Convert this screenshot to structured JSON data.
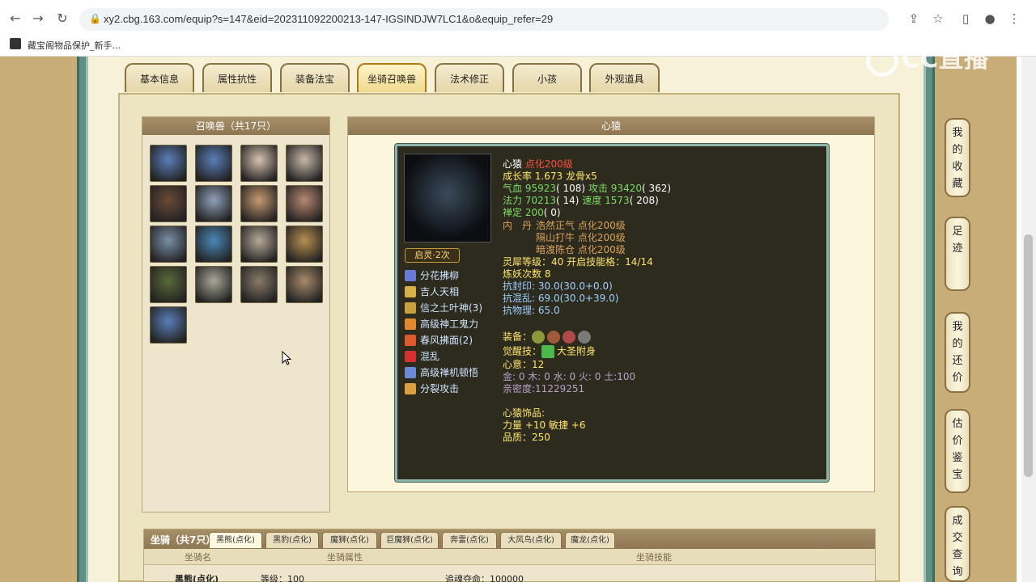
{
  "browser": {
    "url": "xy2.cbg.163.com/equip?s=147&eid=202311092200213-147-IGSINDJW7LC1&o&equip_refer=29",
    "bookmark": "藏宝阁物品保护_新手..."
  },
  "logo": {
    "text": "CC直播"
  },
  "tabs": [
    {
      "label": "基本信息",
      "active": false
    },
    {
      "label": "属性抗性",
      "active": false
    },
    {
      "label": "装备法宝",
      "active": false
    },
    {
      "label": "坐骑召唤兽",
      "active": true
    },
    {
      "label": "法术修正",
      "active": false
    },
    {
      "label": "小孩",
      "active": false
    },
    {
      "label": "外观道具",
      "active": false
    }
  ],
  "pets": {
    "header": "召唤兽（共17只）",
    "colors": [
      "#5a7fb8",
      "#5a7fb8",
      "#d8c2b0",
      "#c9b8a8",
      "#6b4a38",
      "#8fa0b8",
      "#c89a70",
      "#b88870",
      "#7a8fa8",
      "#4a88b8",
      "#b8a898",
      "#b89050",
      "#5a6a3a",
      "#a8a898",
      "#8a7a6a",
      "#a88a6a",
      "#5a7fb8"
    ]
  },
  "detail": {
    "header": "心猿",
    "name": "心猿",
    "level": "点化200级",
    "growth": "成长率 1.673 龙骨x5",
    "hp_label": "气血",
    "hp": "95923",
    "hp_base": "( 108)",
    "atk_label": "攻击",
    "atk": "93420",
    "atk_base": "( 362)",
    "mp_label": "法力",
    "mp": "70213",
    "mp_base": "( 14)",
    "spd_label": "速度",
    "spd": "1573",
    "spd_base": "( 208)",
    "calm_label": "禅定",
    "calm": "200",
    "calm_base": "( 0)",
    "neidan_label": "内　丹",
    "neidan": [
      "浩然正气 点化200级",
      "隔山打牛 点化200级",
      "暗渡陈仓 点化200级"
    ],
    "lingxi": "灵犀等级：",
    "lingxi_val": "40",
    "lingxi_open": "开启技能格：",
    "lingxi_open_val": "14/14",
    "lianyao": "炼妖次数",
    "lianyao_val": "8",
    "kangfeng": "抗封印: 30.0(30.0+0.0)",
    "kanghun": "抗混乱: 69.0(30.0+39.0)",
    "kangwu": "抗物理: 65.0",
    "equip_label": "装备：",
    "awaken_label": "觉醒技：",
    "awaken": "大圣附身",
    "xinyi_label": "心意：",
    "xinyi": "12",
    "elements": "金: 0 木: 0 水: 0 火: 0 土:100",
    "intimacy": "亲密度:11229251",
    "ornament_label": "心猿饰品:",
    "ornament": "力量 +10 敏捷 +6",
    "quality": "品质：250",
    "qiling": "启灵·2次",
    "skills": [
      "分花拂柳",
      "吉人天相",
      "信之土叶神(3)",
      "高级神工鬼力",
      "春风拂面(2)",
      "混乱",
      "高级禅机顿悟",
      "分裂攻击"
    ],
    "skill_colors": [
      "#6a7ad8",
      "#d8b04a",
      "#c8a040",
      "#e08a30",
      "#e05a30",
      "#d83030",
      "#6a8ad8",
      "#d8a040"
    ],
    "equip_colors": [
      "#8a9a3a",
      "#a05a3a",
      "#b04a4a",
      "#7a7a7a"
    ]
  },
  "mount": {
    "title": "坐骑（共7只）",
    "tabs": [
      "黑熊(点化)",
      "黑豹(点化)",
      "魔狮(点化)",
      "巨魔狮(点化)",
      "奔雷(点化)",
      "大风鸟(点化)",
      "魔龙(点化)"
    ],
    "cols": [
      "坐骑名",
      "坐骑属性",
      "坐骑技能"
    ],
    "row_name": "黑熊(点化)",
    "row_attr": "等级：100",
    "row_skill": "追魂夺命：100000"
  },
  "side": [
    "我的收藏",
    "足迹",
    "我的还价",
    "估价鉴宝",
    "成交查询"
  ]
}
